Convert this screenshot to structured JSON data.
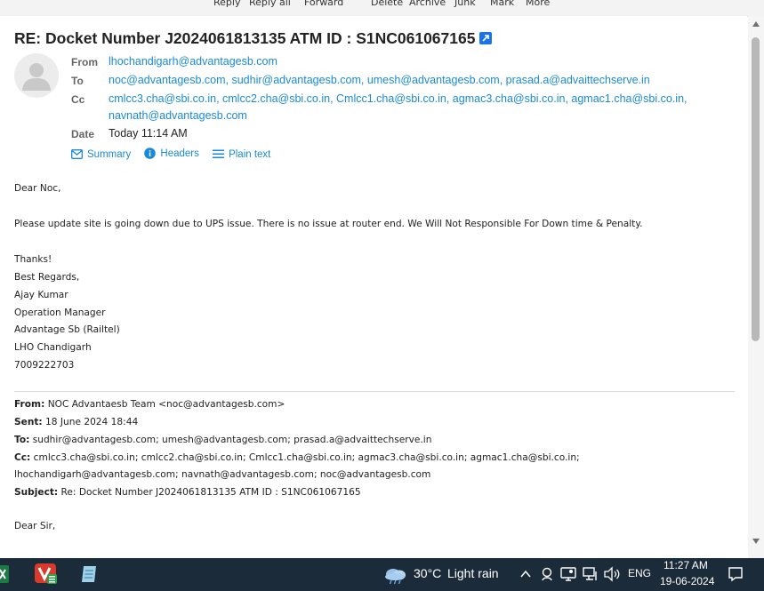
{
  "toolbar": {
    "reply": "Reply",
    "reply_all": "Reply all",
    "forward": "Forward",
    "delete": "Delete",
    "archive": "Archive",
    "junk": "Junk",
    "mark": "Mark",
    "more": "More"
  },
  "message": {
    "subject": "RE: Docket Number J2024061813135 ATM ID : S1NC061067165",
    "from_label": "From",
    "from": "lhochandigarh@advantagesb.com",
    "to_label": "To",
    "to": "noc@advantagesb.com, sudhir@advantagesb.com, umesh@advantagesb.com, prasad.a@advaittechserve.in",
    "cc_label": "Cc",
    "cc_line1": "cmlcc3.cha@sbi.co.in, cmlcc2.cha@sbi.co.in, Cmlcc1.cha@sbi.co.in, agmac3.cha@sbi.co.in, agmac1.cha@sbi.co.in,",
    "cc_line2": "navnath@advantagesb.com",
    "date_label": "Date",
    "date": "Today 11:14 AM",
    "views": {
      "summary": "Summary",
      "headers": "Headers",
      "plain_text": "Plain text"
    }
  },
  "body": {
    "greeting": "Dear Noc,",
    "para1": "Please update site is going down due to UPS issue. There is no issue at router end. We Will Not Responsible For Down time & Penalty.",
    "thanks": "Thanks!",
    "regards": "Best Regards,",
    "name": "Ajay Kumar",
    "title": "Operation Manager",
    "company": "Advantage Sb (Railtel)",
    "office": "LHO Chandigarh",
    "phone": "7009222703"
  },
  "quoted": {
    "from_label": "From:",
    "from": "NOC Advantaesb Team <noc@advantagesb.com>",
    "sent_label": "Sent:",
    "sent": "18 June 2024 18:44",
    "to_label": "To:",
    "to": "sudhir@advantagesb.com; umesh@advantagesb.com; prasad.a@advaittechserve.in",
    "cc_label": "Cc:",
    "cc_line1": "cmlcc3.cha@sbi.co.in; cmlcc2.cha@sbi.co.in; Cmlcc1.cha@sbi.co.in; agmac3.cha@sbi.co.in; agmac1.cha@sbi.co.in;",
    "cc_line2": "lhochandigarh@advantagesb.com; navnath@advantagesb.com; noc@advantagesb.com",
    "subject_label": "Subject:",
    "subject": "Re: Docket Number J2024061813135 ATM ID : S1NC061067165",
    "greeting": "Dear Sir,"
  },
  "taskbar": {
    "weather_temp": "30°C",
    "weather_text": "Light rain",
    "language": "ENG",
    "time": "11:27 AM",
    "date": "19-06-2024"
  },
  "colors": {
    "link": "#1a8ad6",
    "taskbar": "#1c2b3a"
  }
}
